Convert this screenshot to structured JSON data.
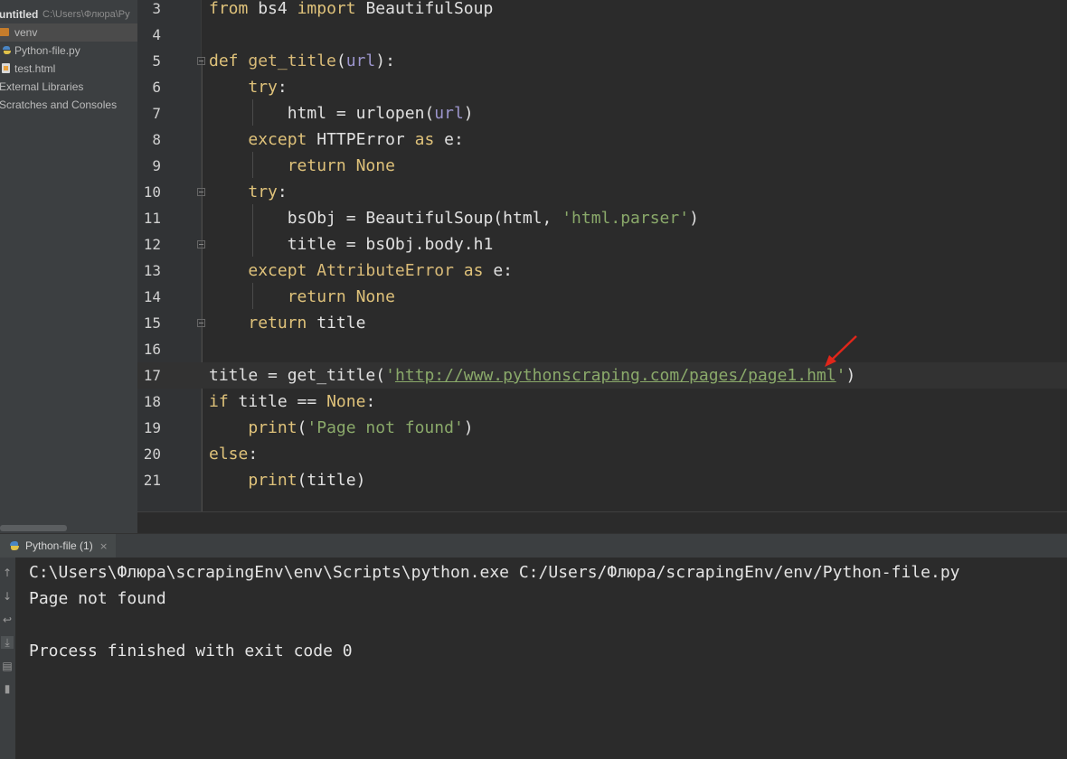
{
  "project": {
    "root_name": "untitled",
    "root_path": "C:\\Users\\Флюра\\Py",
    "items": [
      {
        "label": "venv",
        "icon": "folder-icon"
      },
      {
        "label": "Python-file.py",
        "icon": "python-file-icon"
      },
      {
        "label": "test.html",
        "icon": "html-file-icon"
      },
      {
        "label": "External Libraries",
        "icon": "library-icon"
      },
      {
        "label": "Scratches and Consoles",
        "icon": "scratches-icon"
      }
    ]
  },
  "editor": {
    "lines": [
      {
        "n": "3",
        "text": "from bs4 import BeautifulSoup"
      },
      {
        "n": "4",
        "text": ""
      },
      {
        "n": "5",
        "text": "def get_title(url):"
      },
      {
        "n": "6",
        "text": "    try:"
      },
      {
        "n": "7",
        "text": "        html = urlopen(url)"
      },
      {
        "n": "8",
        "text": "    except HTTPError as e:"
      },
      {
        "n": "9",
        "text": "        return None"
      },
      {
        "n": "10",
        "text": "    try:"
      },
      {
        "n": "11",
        "text": "        bsObj = BeautifulSoup(html, 'html.parser')"
      },
      {
        "n": "12",
        "text": "        title = bsObj.body.h1"
      },
      {
        "n": "13",
        "text": "    except AttributeError as e:"
      },
      {
        "n": "14",
        "text": "        return None"
      },
      {
        "n": "15",
        "text": "    return title"
      },
      {
        "n": "16",
        "text": ""
      },
      {
        "n": "17",
        "text": "title = get_title('http://www.pythonscraping.com/pages/page1.hml')"
      },
      {
        "n": "18",
        "text": "if title == None:"
      },
      {
        "n": "19",
        "text": "    print('Page not found')"
      },
      {
        "n": "20",
        "text": "else:"
      },
      {
        "n": "21",
        "text": "    print(title)"
      }
    ],
    "current_line": "17"
  },
  "run": {
    "tab_label": "Python-file (1)",
    "tab_close": "×",
    "console_lines": [
      "C:\\Users\\Флюра\\scrapingEnv\\env\\Scripts\\python.exe C:/Users/Флюра/scrapingEnv/env/Python-file.py",
      "Page not found",
      "",
      "Process finished with exit code 0"
    ]
  },
  "colors": {
    "keyword": "#dfc27a",
    "string": "#8aa96a",
    "parameter": "#9c95cc",
    "annotation_arrow": "#e0261a"
  }
}
